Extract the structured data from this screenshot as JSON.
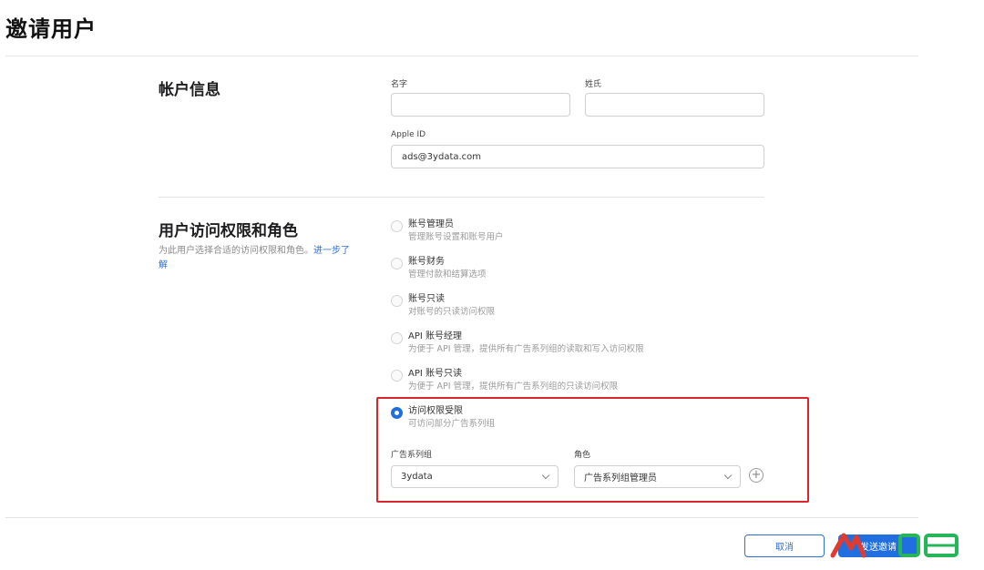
{
  "page": {
    "title": "邀请用户"
  },
  "account_info": {
    "title": "帐户信息",
    "first_name": {
      "label": "名字",
      "value": ""
    },
    "last_name": {
      "label": "姓氏",
      "value": ""
    },
    "apple_id": {
      "label": "Apple ID",
      "value": "ads@3ydata.com"
    }
  },
  "access": {
    "title": "用户访问权限和角色",
    "desc": "为此用户选择合适的访问权限和角色。",
    "learn_more": "进一步了解",
    "roles": [
      {
        "title": "账号管理员",
        "desc": "管理账号设置和账号用户",
        "checked": false
      },
      {
        "title": "账号财务",
        "desc": "管理付款和结算选项",
        "checked": false
      },
      {
        "title": "账号只读",
        "desc": "对账号的只读访问权限",
        "checked": false
      },
      {
        "title": "API 账号经理",
        "desc": "为便于 API 管理，提供所有广告系列组的读取和写入访问权限",
        "checked": false
      },
      {
        "title": "API 账号只读",
        "desc": "为便于 API 管理，提供所有广告系列组的只读访问权限",
        "checked": false
      },
      {
        "title": "访问权限受限",
        "desc": "可访问部分广告系列组",
        "checked": true
      }
    ],
    "campaign_group": {
      "label": "广告系列组",
      "value": "3ydata"
    },
    "role": {
      "label": "角色",
      "value": "广告系列组管理员"
    }
  },
  "footer": {
    "cancel_label": "取消",
    "send_label": "发送邀请"
  },
  "colors": {
    "accent": "#1f6fe0",
    "highlight": "#d9262c"
  },
  "icons": {
    "add": "plus-circle-icon",
    "dropdown": "chevron-down-icon"
  }
}
